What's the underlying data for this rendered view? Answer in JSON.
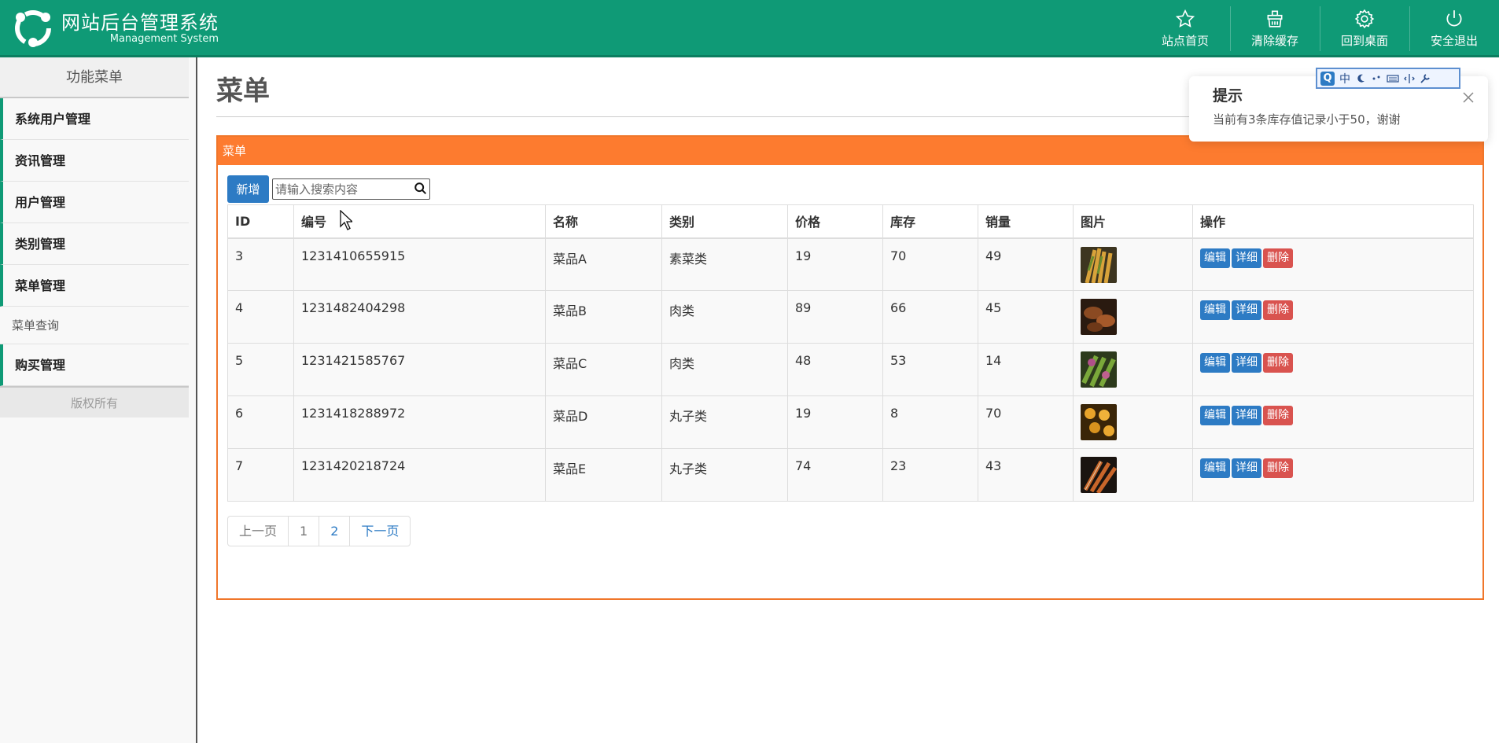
{
  "header": {
    "title": "网站后台管理系统",
    "subtitle": "Management System",
    "nav": [
      {
        "label": "站点首页",
        "icon": "star-icon"
      },
      {
        "label": "清除缓存",
        "icon": "basket-icon"
      },
      {
        "label": "回到桌面",
        "icon": "gear-icon"
      },
      {
        "label": "安全退出",
        "icon": "power-icon"
      }
    ],
    "brand_color": "#0f9a76"
  },
  "sidebar": {
    "heading": "功能菜单",
    "items": [
      {
        "label": "系统用户管理"
      },
      {
        "label": "资讯管理"
      },
      {
        "label": "用户管理"
      },
      {
        "label": "类别管理"
      },
      {
        "label": "菜单管理"
      }
    ],
    "sub_item": "菜单查询",
    "last_item": "购买管理",
    "footer": "版权所有"
  },
  "main": {
    "page_title": "菜单",
    "panel_title": "菜单",
    "panel_color": "#fd7b2f",
    "add_button": "新增",
    "search_placeholder": "请输入搜索内容",
    "columns": [
      "ID",
      "编号",
      "名称",
      "类别",
      "价格",
      "库存",
      "销量",
      "图片",
      "操作"
    ],
    "rows": [
      {
        "id": "3",
        "code": "1231410655915",
        "name": "菜品A",
        "category": "素菜类",
        "price": "19",
        "stock": "70",
        "sales": "49"
      },
      {
        "id": "4",
        "code": "1231482404298",
        "name": "菜品B",
        "category": "肉类",
        "price": "89",
        "stock": "66",
        "sales": "45"
      },
      {
        "id": "5",
        "code": "1231421585767",
        "name": "菜品C",
        "category": "肉类",
        "price": "48",
        "stock": "53",
        "sales": "14"
      },
      {
        "id": "6",
        "code": "1231418288972",
        "name": "菜品D",
        "category": "丸子类",
        "price": "19",
        "stock": "8",
        "sales": "70"
      },
      {
        "id": "7",
        "code": "1231420218724",
        "name": "菜品E",
        "category": "丸子类",
        "price": "74",
        "stock": "23",
        "sales": "43"
      }
    ],
    "actions": {
      "edit": "编辑",
      "detail": "详细",
      "delete": "删除"
    },
    "pager": {
      "prev": "上一页",
      "pages": [
        "1",
        "2"
      ],
      "next": "下一页"
    }
  },
  "toast": {
    "title": "提示",
    "message": "当前有3条库存值记录小于50，谢谢"
  },
  "ime": {
    "q": "Q",
    "lang": "中"
  }
}
